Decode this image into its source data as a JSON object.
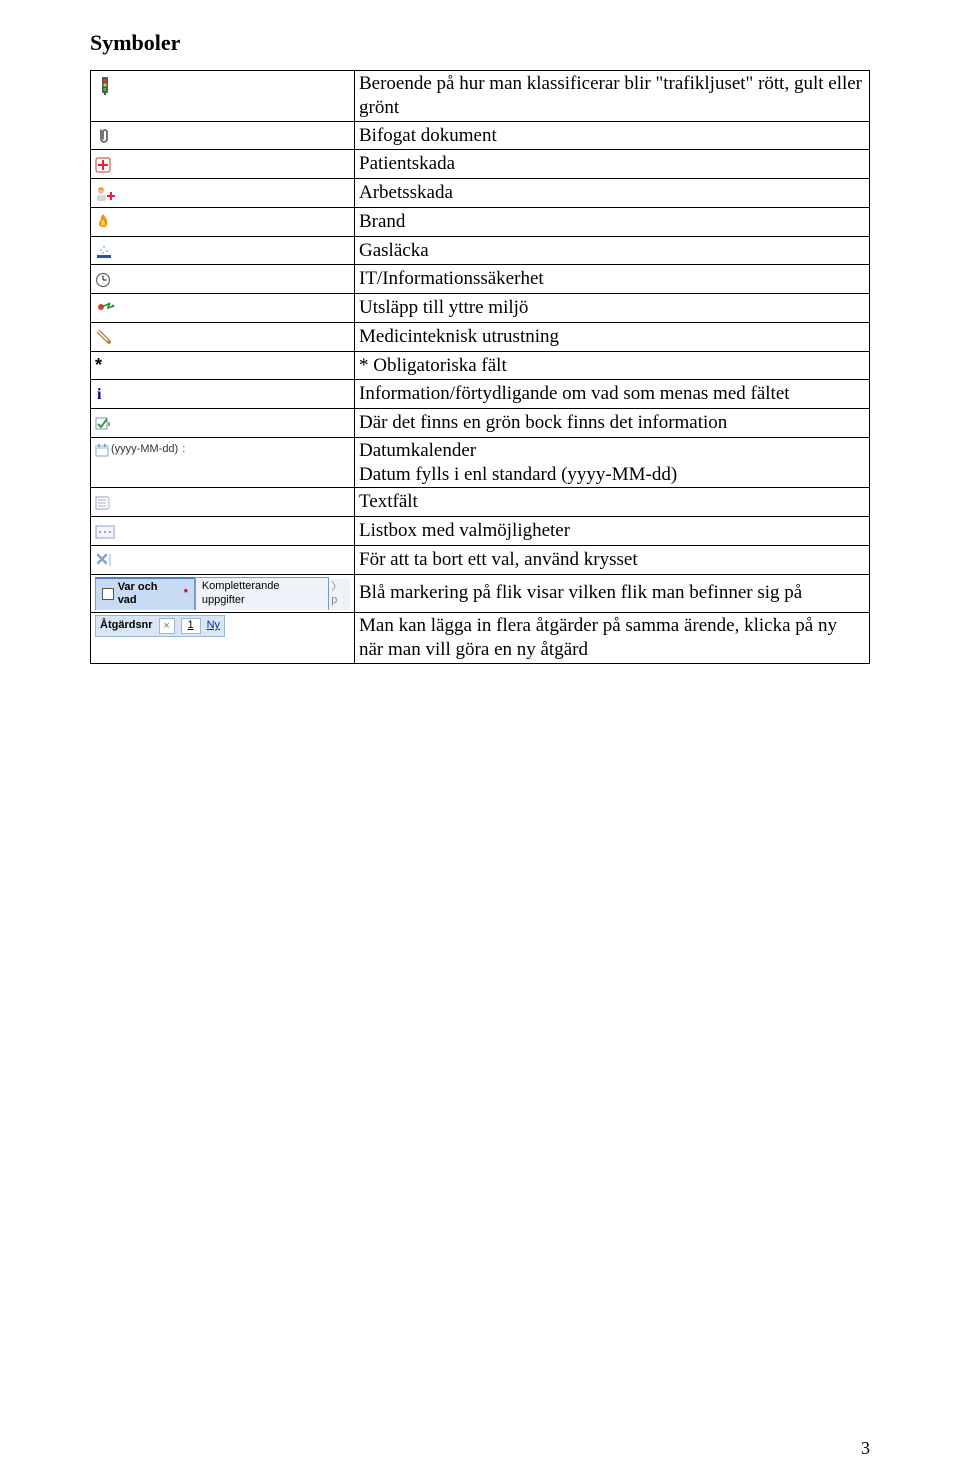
{
  "page": {
    "title": "Symboler",
    "page_number": "3"
  },
  "rows": [
    {
      "icon": "traffic-light",
      "desc": "Beroende på hur man klassificerar blir \"trafikljuset\" rött, gult eller grönt"
    },
    {
      "icon": "paperclip",
      "desc": "Bifogat dokument"
    },
    {
      "icon": "patient-plus",
      "desc": "Patientskada"
    },
    {
      "icon": "worker-plus",
      "desc": "Arbetsskada"
    },
    {
      "icon": "fire",
      "desc": "Brand"
    },
    {
      "icon": "gas",
      "desc": "Gasläcka"
    },
    {
      "icon": "clock",
      "desc": "IT/Informationssäkerhet"
    },
    {
      "icon": "env",
      "desc": "Utsläpp till yttre miljö"
    },
    {
      "icon": "medtech",
      "desc": "Medicinteknisk utrustning"
    },
    {
      "icon": "asterisk",
      "desc": "* Obligatoriska fält"
    },
    {
      "icon": "info-i",
      "desc": "Information/förtydligande om vad som menas med fältet"
    },
    {
      "icon": "green-check",
      "desc": "Där det finns en grön bock finns det information"
    },
    {
      "icon": "date-format",
      "desc2line_a": "Datumkalender",
      "desc2line_b": "Datum fylls i enl standard (yyyy-MM-dd)"
    },
    {
      "icon": "textfield",
      "desc": "Textfält"
    },
    {
      "icon": "listbox",
      "desc": "Listbox med valmöjligheter"
    },
    {
      "icon": "xremove",
      "desc": "För att ta bort ett val, använd krysset"
    },
    {
      "icon": "tabs",
      "desc": "Blå markering på flik visar vilken flik man befinner sig på"
    },
    {
      "icon": "atgards",
      "desc": "Man kan lägga in flera åtgärder på samma ärende, klicka på ny när man vill göra en ny åtgärd"
    }
  ],
  "widgets": {
    "date_format_label": "(yyyy-MM-dd)",
    "tabs": {
      "active_label": "Var och vad",
      "second_label": "Kompletterande uppgifter",
      "asterisk": "*"
    },
    "atgards": {
      "label": "Åtgärdsnr",
      "x": "×",
      "num": "1",
      "ny": "Ny"
    }
  }
}
